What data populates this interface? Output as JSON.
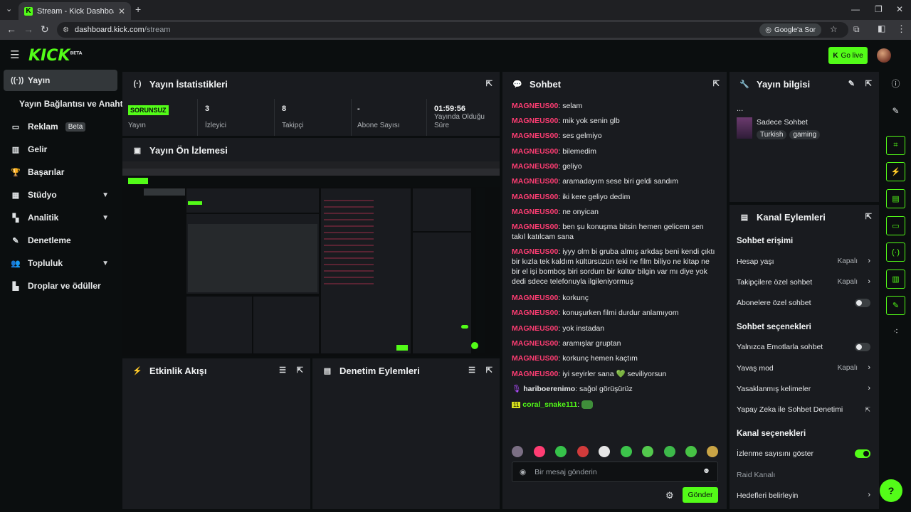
{
  "browser": {
    "tab_title": "Stream - Kick Dashboard",
    "url_host": "dashboard.kick.com",
    "url_path": "/stream",
    "google_pill": "Google'a Sor"
  },
  "header": {
    "logo": "KICK",
    "logo_sup": "BETA",
    "go_live": "Go live"
  },
  "sidebar": {
    "items": [
      {
        "label": "Yayın"
      },
      {
        "label": "Yayın Bağlantısı ve Anahtarı"
      },
      {
        "label": "Reklam",
        "badge": "Beta"
      },
      {
        "label": "Gelir"
      },
      {
        "label": "Başarılar"
      },
      {
        "label": "Stüdyo"
      },
      {
        "label": "Analitik"
      },
      {
        "label": "Denetleme"
      },
      {
        "label": "Topluluk"
      },
      {
        "label": "Droplar ve ödüller"
      }
    ]
  },
  "stats": {
    "title": "Yayın İstatistikleri",
    "status_badge": "SORUNSUZ",
    "status_label": "Yayın",
    "viewers_value": "3",
    "viewers_label": "İzleyici",
    "followers_value": "8",
    "followers_label": "Takipçi",
    "subs_value": "-",
    "subs_label": "Abone Sayısı",
    "duration_value": "01:59:56",
    "duration_label_1": "Yayında Olduğu",
    "duration_label_2": "Süre"
  },
  "preview": {
    "title": "Yayın Ön İzlemesi"
  },
  "activity": {
    "title": "Etkinlik Akışı"
  },
  "moderation": {
    "title": "Denetim Eylemleri"
  },
  "chat": {
    "title": "Sohbet",
    "messages": [
      {
        "user": "MAGNEUS00",
        "text": ": selam"
      },
      {
        "user": "MAGNEUS00",
        "text": ": mik yok senin glb"
      },
      {
        "user": "MAGNEUS00",
        "text": ": ses gelmiyo"
      },
      {
        "user": "MAGNEUS00",
        "text": ": bilemedim"
      },
      {
        "user": "MAGNEUS00",
        "text": ": geliyo"
      },
      {
        "user": "MAGNEUS00",
        "text": ": aramadayım sese biri geldi sandım"
      },
      {
        "user": "MAGNEUS00",
        "text": ": iki kere geliyo dedim"
      },
      {
        "user": "MAGNEUS00",
        "text": ": ne onyican"
      },
      {
        "user": "MAGNEUS00",
        "text": ": ben şu konuşma bitsin hemen gelicem sen takıl katılcam sana"
      },
      {
        "user": "MAGNEUS00",
        "text": ": iyyy olm bi gruba almış arkdaş beni kendi çıktı bir kızla tek kaldım kültürsüzün teki ne film biliyo ne kitap ne bir el işi bomboş biri sordum bir kültür bilgin var mı diye yok dedi sdece telefonuyla ilgileniyormuş"
      },
      {
        "user": "MAGNEUS00",
        "text": ": korkunç"
      },
      {
        "user": "MAGNEUS00",
        "text": ": konuşurken filmi durdur anlamıyom"
      },
      {
        "user": "MAGNEUS00",
        "text": ": yok instadan"
      },
      {
        "user": "MAGNEUS00",
        "text": ": aramışlar gruptan"
      },
      {
        "user": "MAGNEUS00",
        "text": ": korkunç hemen kaçtım"
      },
      {
        "user": "MAGNEUS00",
        "text": ": iyi seyirler sana 💚 seviliyorsun"
      },
      {
        "user": "hariboerenimo",
        "text": ": sağol görüşürüz"
      },
      {
        "user": "coral_snake111",
        "text": ":"
      }
    ],
    "input_placeholder": "Bir mesaj gönderin",
    "send_label": "Gönder"
  },
  "stream_info": {
    "title": "Yayın bilgisi",
    "ellipsis": "...",
    "category": "Sadece Sohbet",
    "tags": [
      "Turkish",
      "gaming"
    ]
  },
  "channel_actions": {
    "title": "Kanal Eylemleri",
    "chat_access_title": "Sohbet erişimi",
    "account_age": "Hesap yaşı",
    "account_age_value": "Kapalı",
    "followers_only": "Takipçilere özel sohbet",
    "followers_only_value": "Kapalı",
    "subs_only": "Abonelere özel sohbet",
    "chat_options_title": "Sohbet seçenekleri",
    "emote_only": "Yalnızca Emotlarla sohbet",
    "slow_mode": "Yavaş mod",
    "slow_mode_value": "Kapalı",
    "banned_words": "Yasaklanmış kelimeler",
    "ai_moderation": "Yapay Zeka ile Sohbet Denetimi",
    "channel_options_title": "Kanal seçenekleri",
    "show_viewcount": "İzlenme sayısını göster",
    "raid_channel": "Raid Kanalı",
    "set_goals": "Hedefleri belirleyin"
  },
  "colors": {
    "accent": "#53fc18",
    "username": "#ff3d73",
    "panel": "#191b1f",
    "background": "#0b0e0f"
  }
}
